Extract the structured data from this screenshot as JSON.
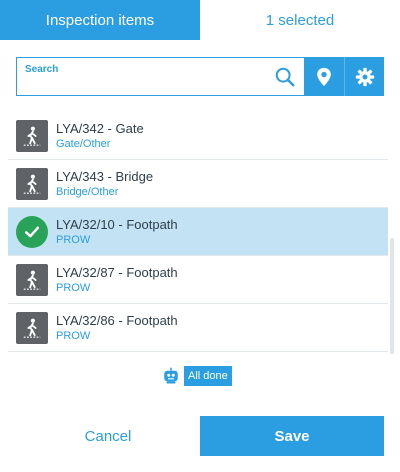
{
  "tabs": {
    "active_label": "Inspection items",
    "selected_label": "1 selected"
  },
  "search": {
    "label": "Search",
    "value": "",
    "placeholder": ""
  },
  "list": {
    "items": [
      {
        "title": "LYA/342 - Gate",
        "subtitle": "Gate/Other",
        "icon": "pedestrian-icon",
        "selected": false
      },
      {
        "title": "LYA/343 - Bridge",
        "subtitle": "Bridge/Other",
        "icon": "pedestrian-icon",
        "selected": false
      },
      {
        "title": "LYA/32/10 - Footpath",
        "subtitle": "PROW",
        "icon": "checkmark-icon",
        "selected": true
      },
      {
        "title": "LYA/32/87 - Footpath",
        "subtitle": "PROW",
        "icon": "pedestrian-icon",
        "selected": false
      },
      {
        "title": "LYA/32/86 - Footpath",
        "subtitle": "PROW",
        "icon": "pedestrian-icon",
        "selected": false
      }
    ]
  },
  "status": {
    "done_label": "All done",
    "icon": "robot-icon"
  },
  "footer": {
    "cancel_label": "Cancel",
    "save_label": "Save"
  },
  "colors": {
    "accent": "#2a9ee0",
    "selected_row": "#c3e3f4",
    "check": "#2aa35a",
    "thumb": "#5f6367"
  }
}
